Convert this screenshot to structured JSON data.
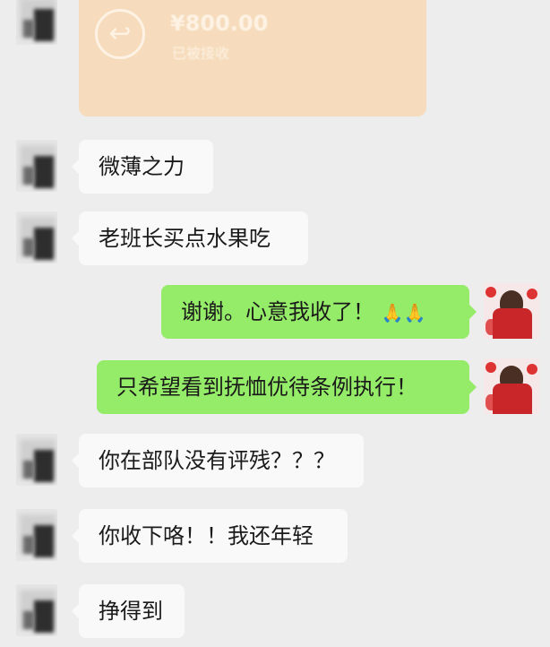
{
  "transfer_card": {
    "amount": "¥800.00",
    "status": "已被接收",
    "icon": "return-arrow-icon"
  },
  "messages": [
    {
      "side": "in",
      "text": "微薄之力"
    },
    {
      "side": "in",
      "text": "老班长买点水果吃"
    },
    {
      "side": "out",
      "text": "谢谢。心意我收了！",
      "emoji": "🙏🙏"
    },
    {
      "side": "out",
      "text": "只希望看到抚恤优待条例执行！"
    },
    {
      "side": "in",
      "text": "你在部队没有评残？？？"
    },
    {
      "side": "in",
      "text": "你收下咯！！我还年轻"
    },
    {
      "side": "in",
      "text": "挣得到"
    }
  ],
  "colors": {
    "background": "#ededed",
    "incoming_bubble": "#f9f9f9",
    "outgoing_bubble": "#95ec69",
    "transfer_card": "#f6dcbc"
  }
}
